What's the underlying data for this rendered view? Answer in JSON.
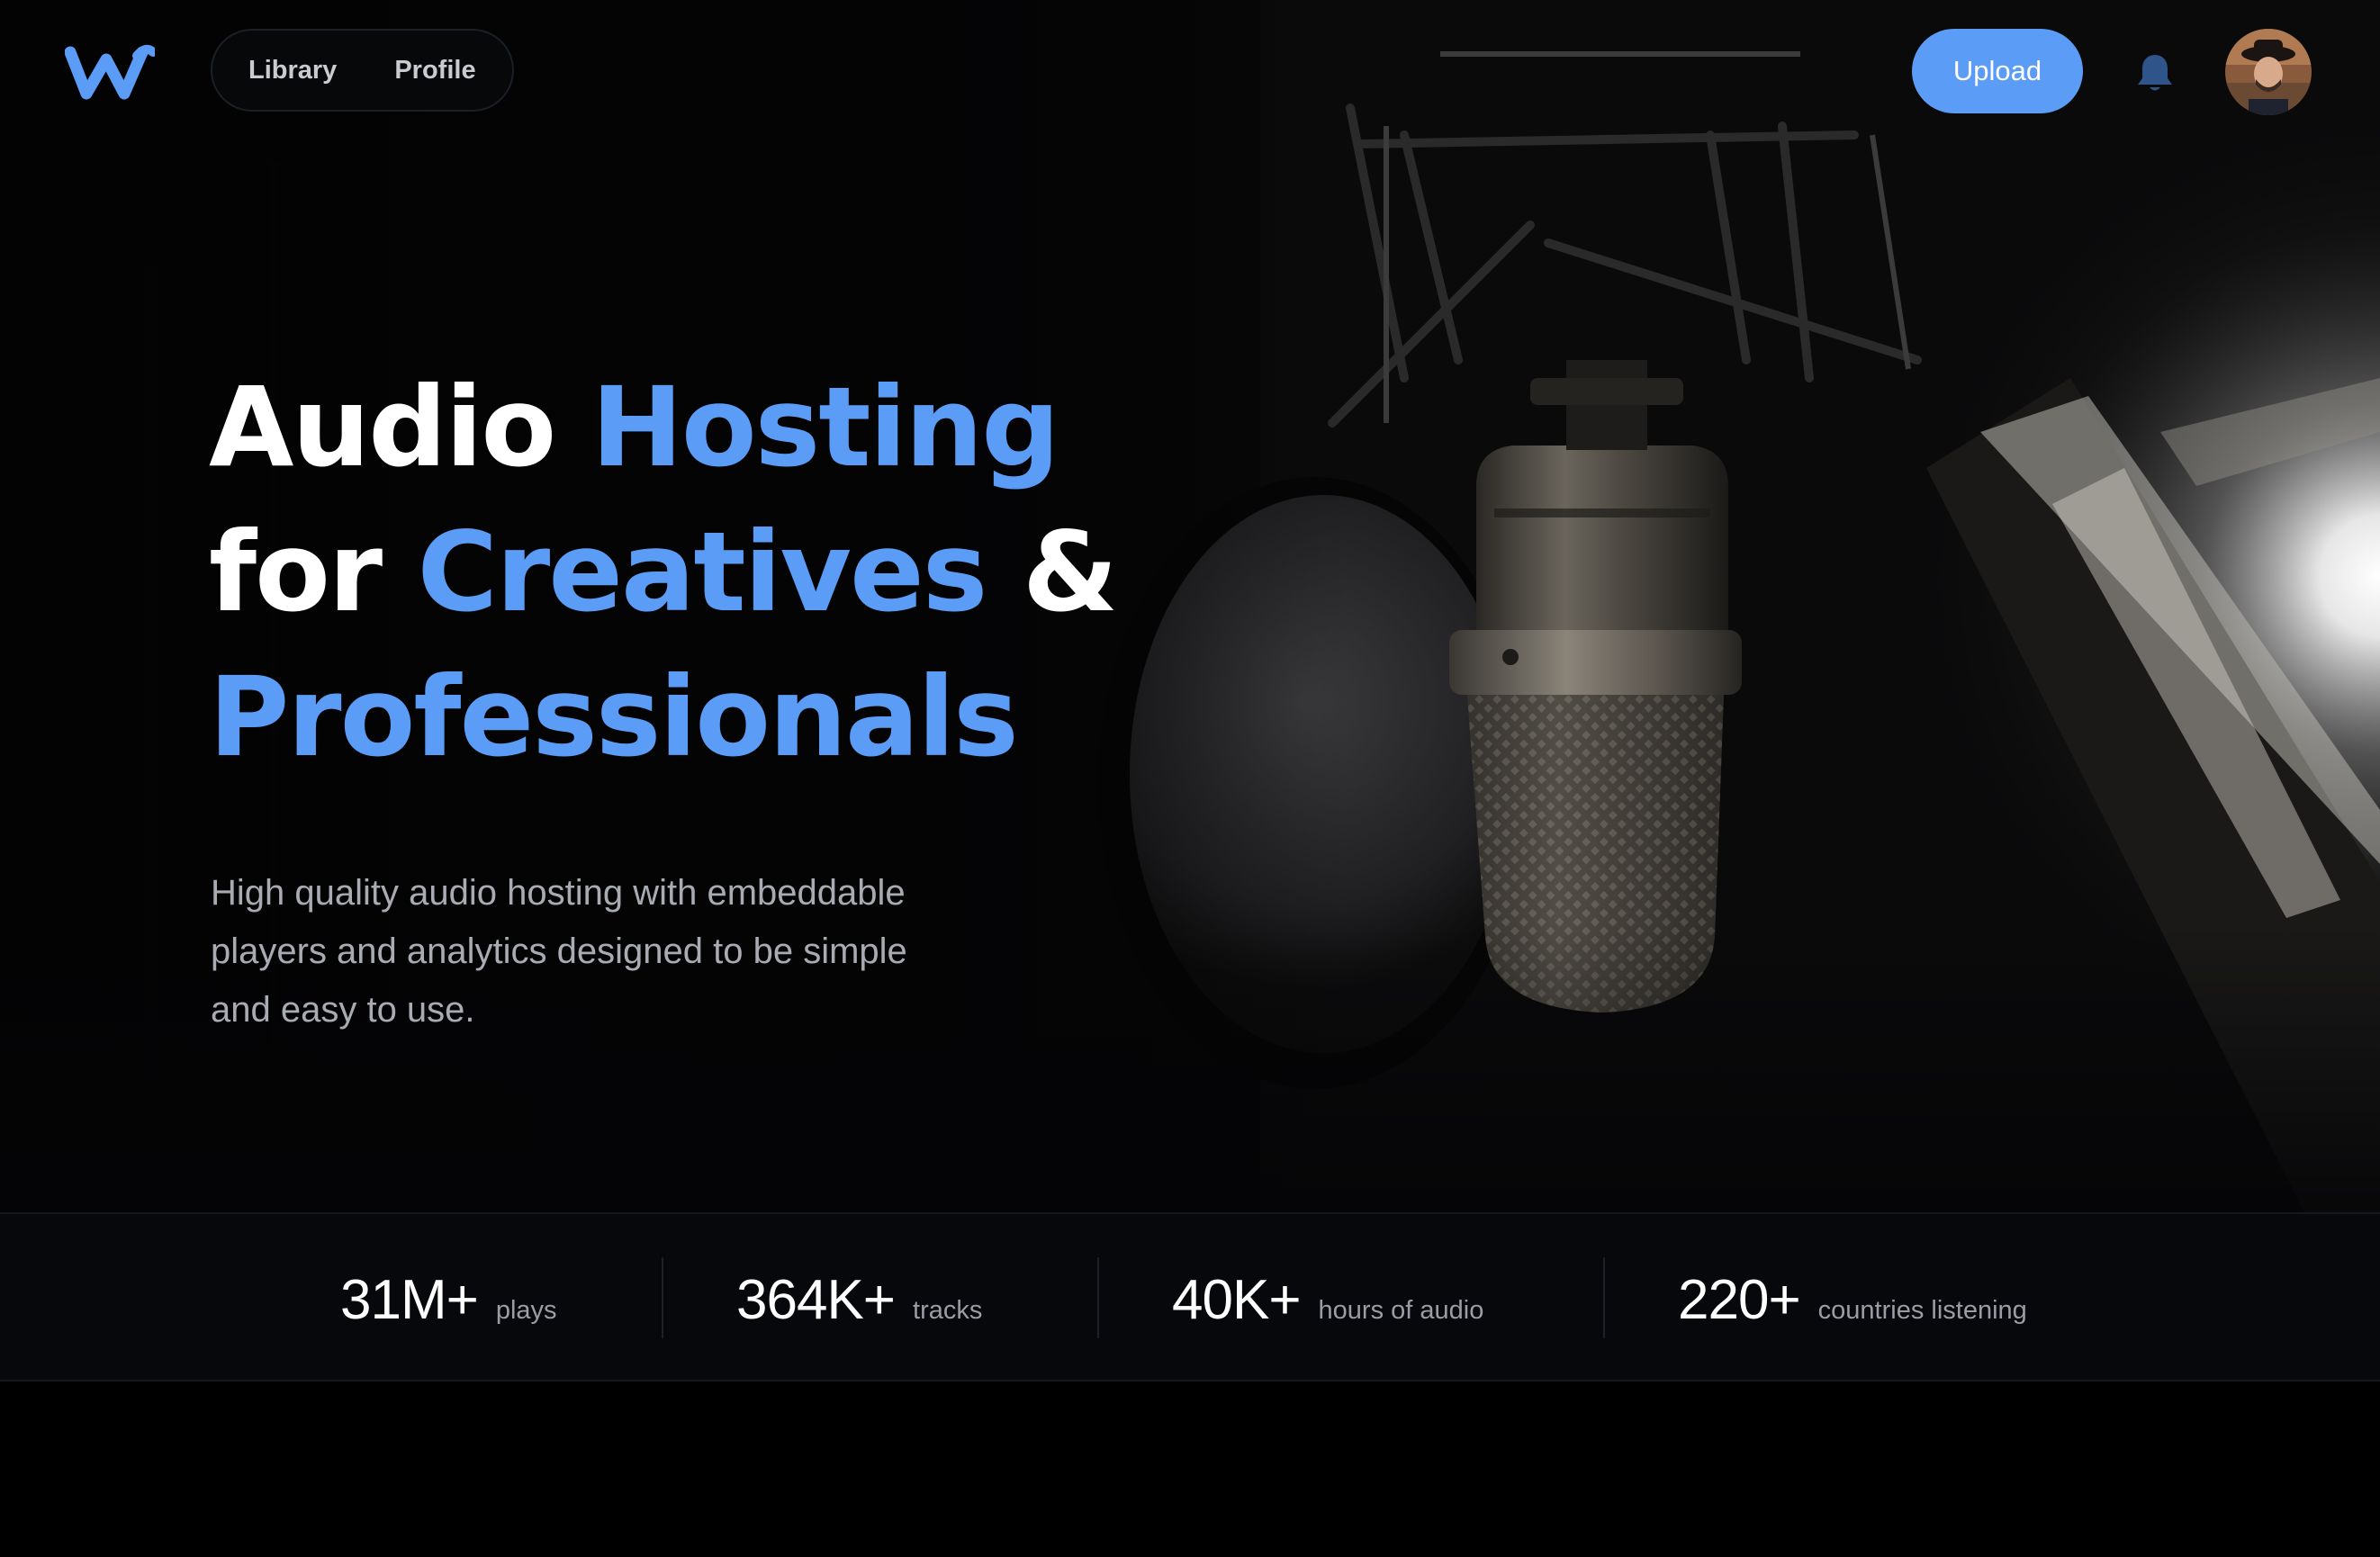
{
  "nav": {
    "logo_icon": "w-logo-icon",
    "links": [
      {
        "label": "Library"
      },
      {
        "label": "Profile"
      }
    ],
    "upload_label": "Upload",
    "bell_icon": "bell-icon",
    "avatar_icon": "user-avatar"
  },
  "hero": {
    "headline": {
      "line1_a": "Audio",
      "line1_b": "Hosting",
      "line2_a": "for",
      "line2_b": "Creatives",
      "line2_c": "&",
      "line3": "Professionals"
    },
    "subtitle": "High quality audio hosting with embeddable players and analytics designed to be simple and easy to use."
  },
  "stats": [
    {
      "value": "31M+",
      "label": "plays"
    },
    {
      "value": "364K+",
      "label": "tracks"
    },
    {
      "value": "40K+",
      "label": "hours of audio"
    },
    {
      "value": "220+",
      "label": "countries listening"
    }
  ],
  "colors": {
    "accent": "#5b9cf6",
    "background": "#000000",
    "text": "#ffffff",
    "muted": "#a8abb2"
  }
}
